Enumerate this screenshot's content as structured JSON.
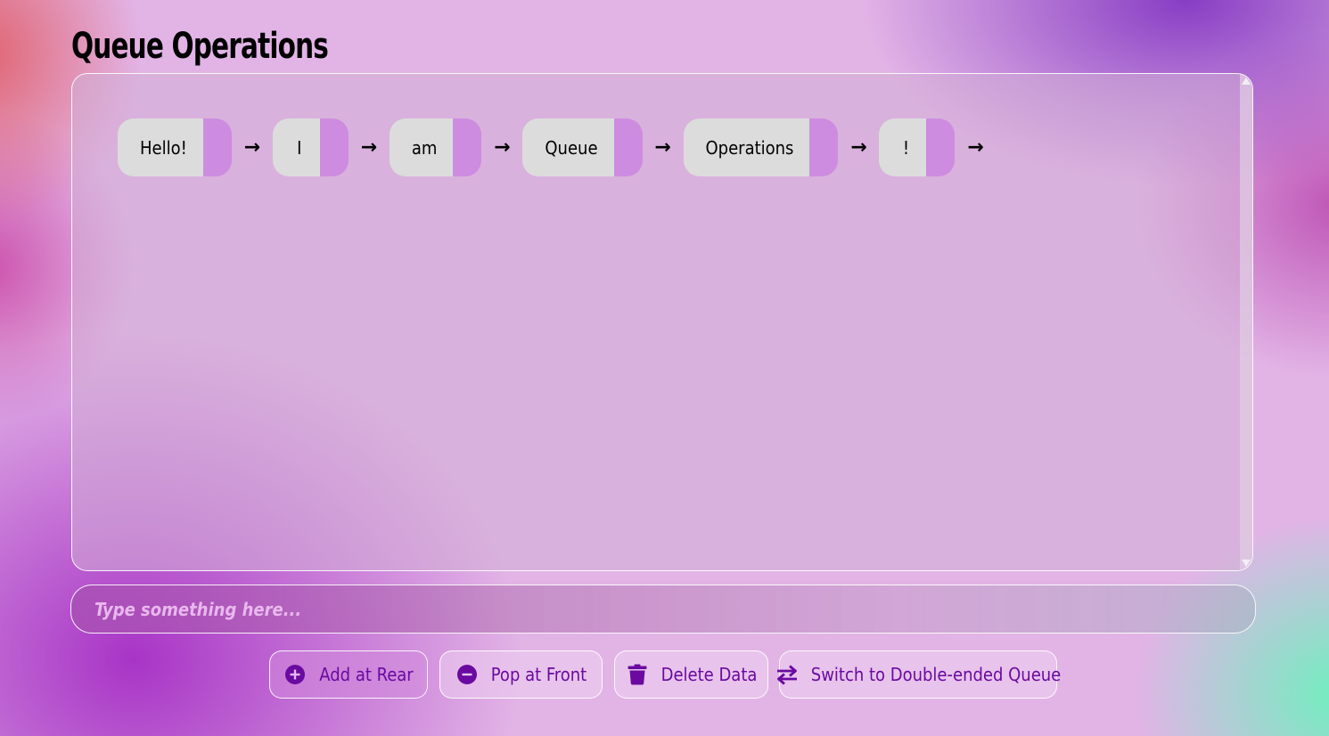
{
  "page": {
    "title": "Queue Operations"
  },
  "queue": {
    "nodes": [
      "Hello!",
      "I",
      "am",
      "Queue",
      "Operations",
      "!"
    ],
    "arrow": "→"
  },
  "input": {
    "placeholder": "Type something here...",
    "value": ""
  },
  "buttons": {
    "add_label": "Add at Rear",
    "pop_label": "Pop at Front",
    "delete_label": "Delete Data",
    "switch_label": "Switch to Double-ended Queue"
  },
  "colors": {
    "accent": "#6a0aa0",
    "node_value_bg": "#dcdcdc",
    "node_pointer_bg": "#cd8ce0"
  }
}
